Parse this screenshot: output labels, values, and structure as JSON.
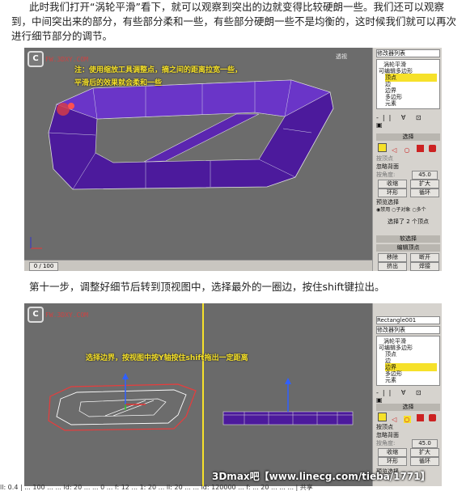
{
  "paragraphs": {
    "p1": "此时我们打开“涡轮平滑”看下，就可以观察到突出的边就变得比较硬朗一些。我们还可以观察到，中间突出来的部分，有些部分柔和一些，有些部分硬朗一些不是均衡的，这时候我们就可以再次进行细节部分的调节。",
    "p2": "第十一步，调整好细节后转到顶视图中，选择最外的一圈边，按住shift键拉出。"
  },
  "shot1": {
    "logo": "C",
    "watermark": "FW.3DXY.COM",
    "note_line1": "注：使用缩放工具调整点，摘之间的距离拉宽一些，",
    "note_line2": "平滑后的效果就会柔和一些",
    "panel": {
      "top_label": "修改器列表",
      "items": [
        "涡轮平滑",
        "可编辑多边形",
        "顶点",
        "边",
        "边界",
        "多边形",
        "元素"
      ],
      "selected_index": 2,
      "select_title": "选择",
      "opt1": "按顶点",
      "opt2": "忽略背面",
      "opt3": "按角度:",
      "angle": "45.0",
      "btn_shrink": "收缩",
      "btn_grow": "扩大",
      "btn_ring": "环形",
      "btn_loop": "循环",
      "preview_title": "预览选择",
      "preview_options": [
        "禁用",
        "子对象",
        "多个"
      ],
      "status": "选择了 2 个顶点",
      "soft_sel": "软选择",
      "edit_vert": "编辑顶点",
      "remove": "移除",
      "break": "断开",
      "extrude": "挤出",
      "weld": "焊接",
      "corner_label": "透视"
    },
    "timeline": "0 / 100"
  },
  "shot2": {
    "logo": "C",
    "watermark": "FW.3DXY.COM",
    "note": "选择边界，按视图中按Y轴按住shift拖出一定距离",
    "panel": {
      "object_name": "Rectangle001",
      "top_label": "修改器列表",
      "items": [
        "涡轮平滑",
        "可编辑多边形",
        "顶点",
        "边",
        "边界",
        "多边形",
        "元素"
      ],
      "selected_index": 4,
      "select_title": "选择",
      "opt1": "按顶点",
      "opt2": "忽略背面",
      "opt3": "按角度:",
      "angle": "45.0",
      "btn_shrink": "收缩",
      "btn_grow": "扩大",
      "btn_ring": "环形",
      "btn_loop": "循环",
      "preview_title": "预览选择"
    }
  },
  "banner": "3Dmax吧【www.linecg.com/tieba/1771】",
  "footer": "ll: 0.4  |  ... 100  ...  ...  ld: 20  ...  ...  0  ...  f: 12  ...  1: 20  ...  ll: 20  ...  ...  ld: 120000  ...  f: ...  20  ...  ...  ...  |  共享"
}
